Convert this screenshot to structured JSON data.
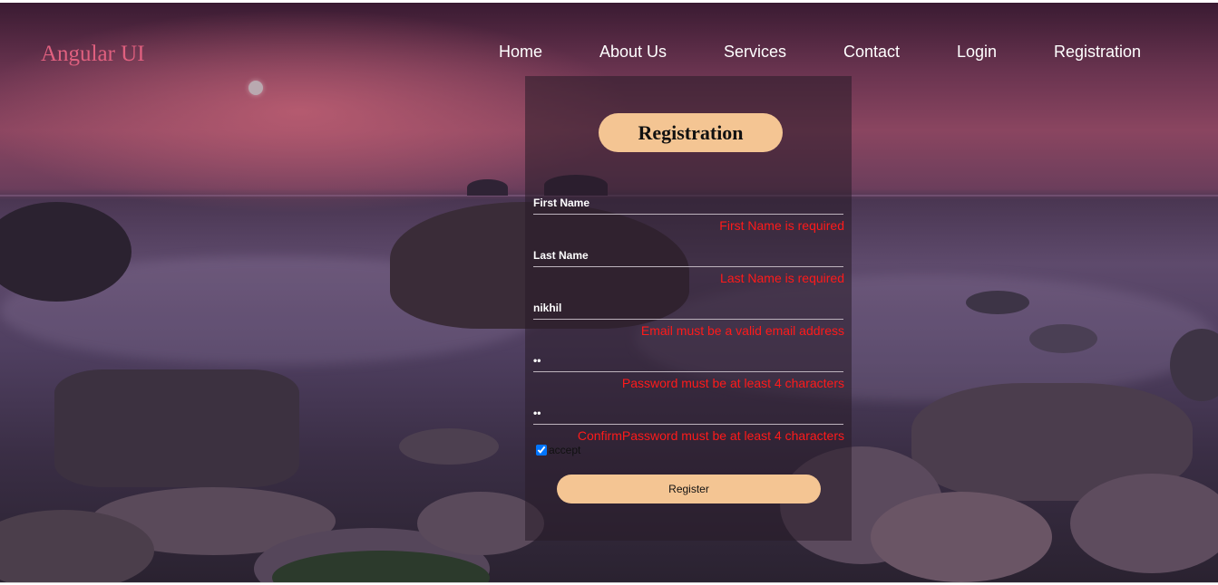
{
  "brand": "Angular UI",
  "nav": [
    "Home",
    "About Us",
    "Services",
    "Contact",
    "Login",
    "Registration"
  ],
  "form": {
    "title": "Registration",
    "first_name": {
      "placeholder": "First Name",
      "value": "",
      "error": "First Name is required"
    },
    "last_name": {
      "placeholder": "Last Name",
      "value": "",
      "error": "Last Name is required"
    },
    "email": {
      "value": "nikhil",
      "error": "Email must be a valid email address"
    },
    "password": {
      "value": "••",
      "error": "Password must be at least 4 characters"
    },
    "confirm_password": {
      "value": "••",
      "error": "ConfirmPassword must be at least 4 characters"
    },
    "accept_label": "accept",
    "accept_checked": true,
    "submit_label": "Register"
  },
  "colors": {
    "brand": "#e0607f",
    "accent": "#f4c593",
    "error": "#ff1a1a"
  }
}
